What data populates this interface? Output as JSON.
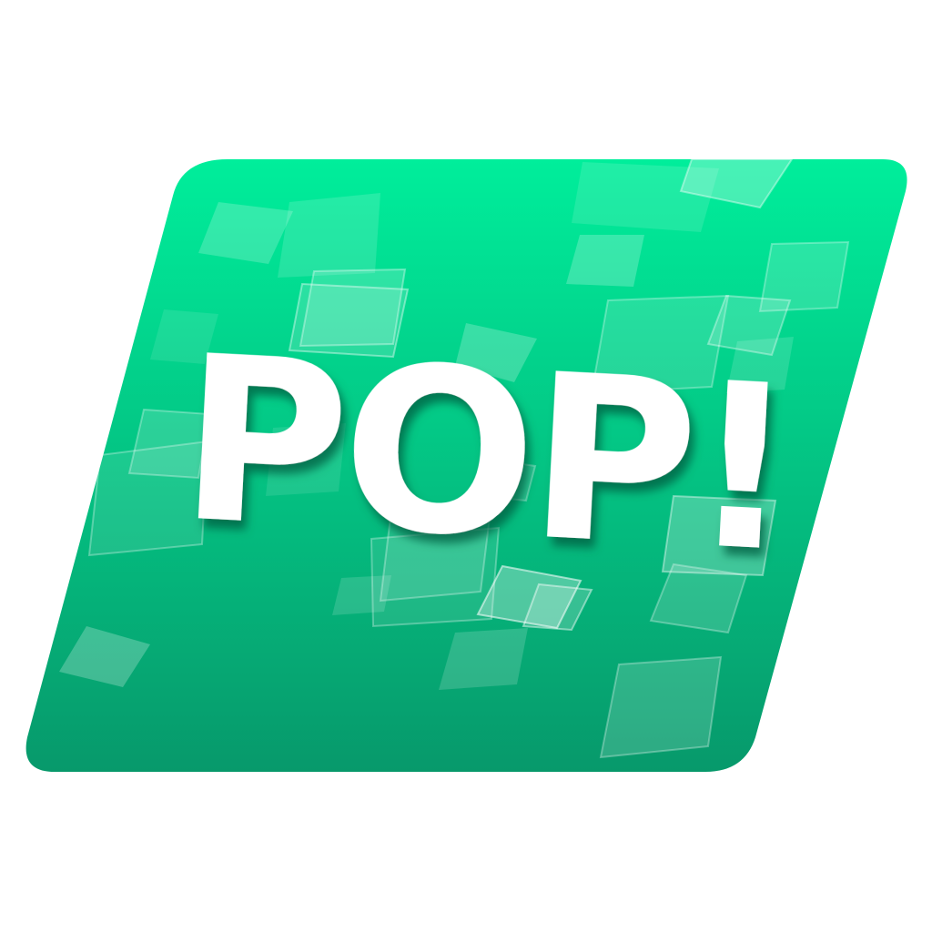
{
  "logo": {
    "text": "POP!",
    "colors": {
      "gradient_top": "#00EE9B",
      "gradient_bottom": "#07996B",
      "text_fill": "#FFFFFF",
      "text_shadow": "#035C40",
      "square_fill": "#FFFFFF"
    }
  }
}
